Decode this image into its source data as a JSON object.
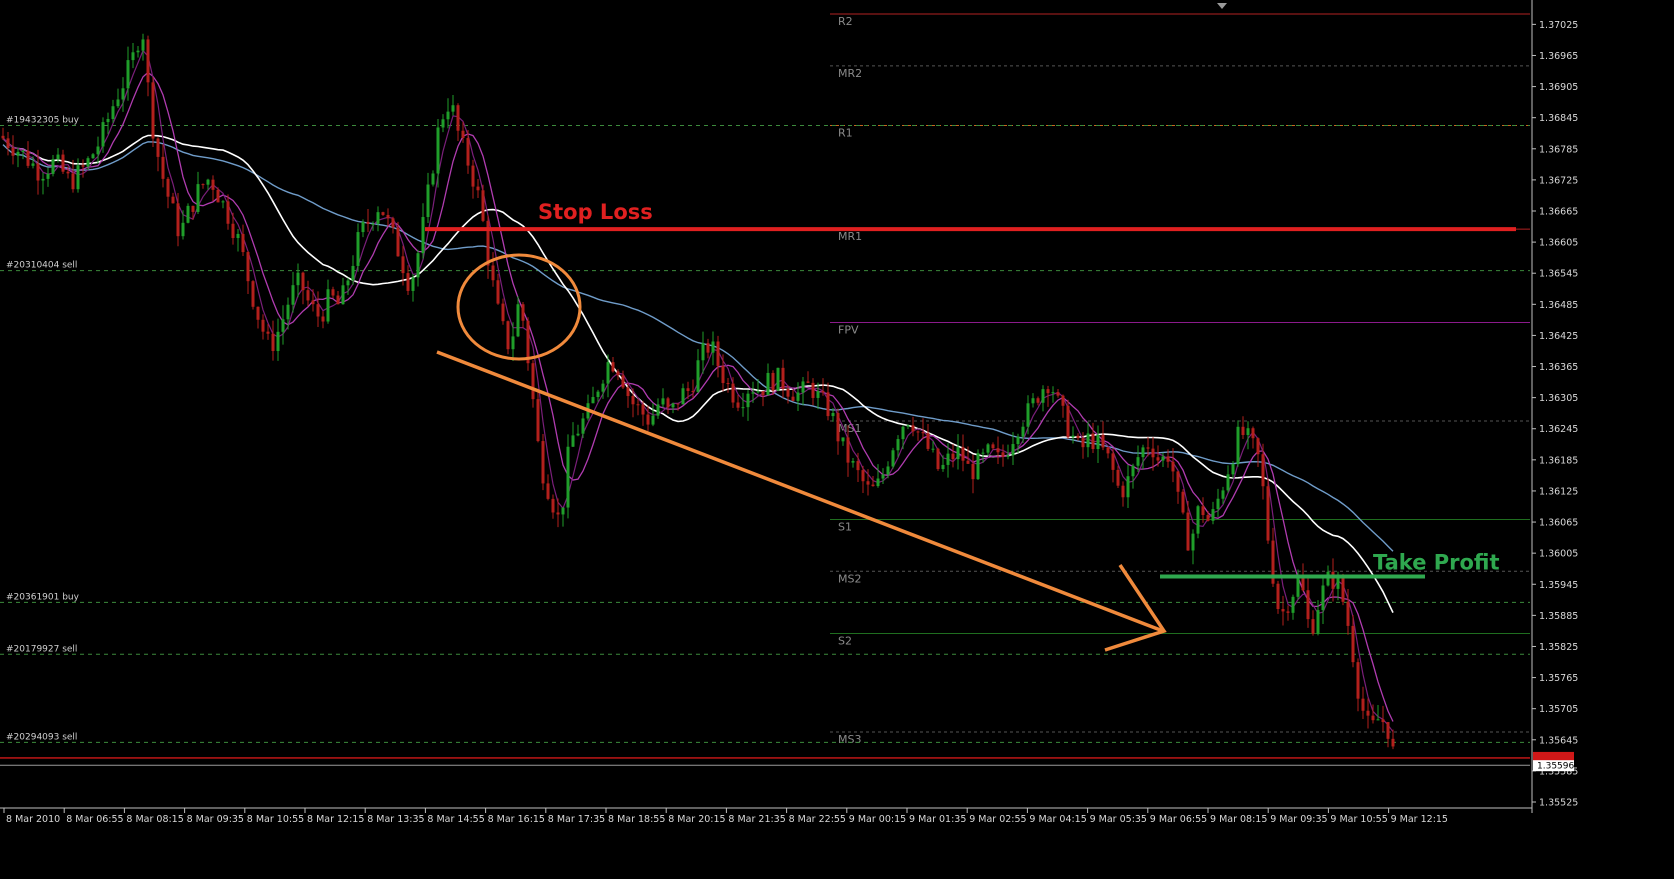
{
  "chart_data": {
    "type": "candlestick",
    "instrument_hint": "",
    "ylim": [
      1.3555,
      1.3705
    ],
    "y_ticks": [
      "1.37025",
      "1.36965",
      "1.36905",
      "1.36845",
      "1.36785",
      "1.36725",
      "1.36665",
      "1.36605",
      "1.36545",
      "1.36485",
      "1.36425",
      "1.36365",
      "1.36305",
      "1.36245",
      "1.36185",
      "1.36125",
      "1.36065",
      "1.36005",
      "1.35945",
      "1.35885",
      "1.35825",
      "1.35765",
      "1.35705",
      "1.35645",
      "1.35585",
      "1.35525"
    ],
    "y_tick_values": [
      1.37025,
      1.36965,
      1.36905,
      1.36845,
      1.36785,
      1.36725,
      1.36665,
      1.36605,
      1.36545,
      1.36485,
      1.36425,
      1.36365,
      1.36305,
      1.36245,
      1.36185,
      1.36125,
      1.36065,
      1.36005,
      1.35945,
      1.35885,
      1.35825,
      1.35765,
      1.35705,
      1.35645,
      1.35585,
      1.35525
    ],
    "x_ticks": [
      "8 Mar 2010",
      "8 Mar 06:55",
      "8 Mar 08:15",
      "8 Mar 09:35",
      "8 Mar 10:55",
      "8 Mar 12:15",
      "8 Mar 13:35",
      "8 Mar 14:55",
      "8 Mar 16:15",
      "8 Mar 17:35",
      "8 Mar 18:55",
      "8 Mar 20:15",
      "8 Mar 21:35",
      "8 Mar 22:55",
      "9 Mar 00:15",
      "9 Mar 01:35",
      "9 Mar 02:55",
      "9 Mar 04:15",
      "9 Mar 05:35",
      "9 Mar 06:55",
      "9 Mar 08:15",
      "9 Mar 09:35",
      "9 Mar 10:55",
      "9 Mar 12:15"
    ],
    "current_price_label": "1.35596",
    "current_price": 1.35596,
    "bid_line": 1.3561,
    "pivot_levels": [
      {
        "label": "R2",
        "value": 1.37045,
        "color": "#b22222",
        "style": "solid"
      },
      {
        "label": "MR2",
        "value": 1.36945,
        "color": "#555555",
        "style": "dashed"
      },
      {
        "label": "R1",
        "value": 1.3683,
        "color": "#c8641e",
        "style": "dashed"
      },
      {
        "label": "MR1",
        "value": 1.3663,
        "color": "#b22222",
        "style": "solid"
      },
      {
        "label": "FPV",
        "value": 1.3645,
        "color": "#8b1a8b",
        "style": "solid"
      },
      {
        "label": "MS1",
        "value": 1.3626,
        "color": "#555555",
        "style": "dashed"
      },
      {
        "label": "S1",
        "value": 1.3607,
        "color": "#1f6e1f",
        "style": "solid"
      },
      {
        "label": "MS2",
        "value": 1.3597,
        "color": "#555555",
        "style": "dashed"
      },
      {
        "label": "S2",
        "value": 1.3585,
        "color": "#1f6e1f",
        "style": "solid"
      },
      {
        "label": "MS3",
        "value": 1.3566,
        "color": "#555555",
        "style": "dashed"
      }
    ],
    "order_lines": [
      {
        "label": "#19432305 buy",
        "value": 1.3683
      },
      {
        "label": "#20310404 sell",
        "value": 1.3655
      },
      {
        "label": "#20361901 buy",
        "value": 1.3591
      },
      {
        "label": "#20179927 sell",
        "value": 1.3581
      },
      {
        "label": "#20294093 sell",
        "value": 1.3564
      }
    ],
    "annotations": {
      "stop_loss": {
        "label": "Stop Loss",
        "value": 1.3663,
        "color": "#e02020"
      },
      "take_profit": {
        "label": "Take Profit",
        "value": 1.3596,
        "color": "#2fa84f"
      },
      "trend_arrow_color": "#f08a3c",
      "circle_color": "#f08a3c"
    },
    "series_anchors": {
      "close": [
        [
          0,
          1.3681
        ],
        [
          20,
          1.3678
        ],
        [
          40,
          1.3674
        ],
        [
          55,
          1.3676
        ],
        [
          70,
          1.3672
        ],
        [
          85,
          1.3675
        ],
        [
          100,
          1.368
        ],
        [
          115,
          1.3688
        ],
        [
          125,
          1.3692
        ],
        [
          135,
          1.3697
        ],
        [
          142,
          1.3703
        ],
        [
          150,
          1.3686
        ],
        [
          160,
          1.3675
        ],
        [
          170,
          1.3668
        ],
        [
          180,
          1.3662
        ],
        [
          190,
          1.3667
        ],
        [
          200,
          1.3671
        ],
        [
          210,
          1.3673
        ],
        [
          220,
          1.3669
        ],
        [
          230,
          1.3665
        ],
        [
          240,
          1.366
        ],
        [
          250,
          1.3652
        ],
        [
          260,
          1.3645
        ],
        [
          270,
          1.364
        ],
        [
          280,
          1.3644
        ],
        [
          290,
          1.365
        ],
        [
          300,
          1.3653
        ],
        [
          310,
          1.3648
        ],
        [
          320,
          1.3646
        ],
        [
          330,
          1.365
        ],
        [
          340,
          1.3648
        ],
        [
          350,
          1.3655
        ],
        [
          360,
          1.3662
        ],
        [
          370,
          1.3665
        ],
        [
          380,
          1.3668
        ],
        [
          390,
          1.3663
        ],
        [
          400,
          1.3658
        ],
        [
          410,
          1.3652
        ],
        [
          420,
          1.366
        ],
        [
          430,
          1.3672
        ],
        [
          440,
          1.3684
        ],
        [
          450,
          1.3688
        ],
        [
          460,
          1.368
        ],
        [
          470,
          1.3675
        ],
        [
          480,
          1.3668
        ],
        [
          490,
          1.3655
        ],
        [
          500,
          1.3645
        ],
        [
          510,
          1.364
        ],
        [
          520,
          1.365
        ],
        [
          530,
          1.3635
        ],
        [
          540,
          1.3618
        ],
        [
          550,
          1.3612
        ],
        [
          560,
          1.3606
        ],
        [
          570,
          1.3622
        ],
        [
          580,
          1.3625
        ],
        [
          590,
          1.3628
        ],
        [
          600,
          1.3634
        ],
        [
          610,
          1.3638
        ],
        [
          620,
          1.3636
        ],
        [
          630,
          1.363
        ],
        [
          640,
          1.3628
        ],
        [
          650,
          1.3626
        ],
        [
          660,
          1.363
        ],
        [
          670,
          1.3627
        ],
        [
          680,
          1.3631
        ],
        [
          690,
          1.3632
        ],
        [
          700,
          1.3638
        ],
        [
          710,
          1.3641
        ],
        [
          720,
          1.3636
        ],
        [
          730,
          1.3632
        ],
        [
          740,
          1.363
        ],
        [
          750,
          1.3633
        ],
        [
          760,
          1.3632
        ],
        [
          770,
          1.3634
        ],
        [
          780,
          1.3634
        ],
        [
          790,
          1.3632
        ],
        [
          800,
          1.3631
        ],
        [
          810,
          1.3633
        ],
        [
          820,
          1.363
        ],
        [
          830,
          1.3628
        ],
        [
          840,
          1.3622
        ],
        [
          850,
          1.3618
        ],
        [
          860,
          1.3615
        ],
        [
          870,
          1.3612
        ],
        [
          880,
          1.3614
        ],
        [
          890,
          1.362
        ],
        [
          900,
          1.3625
        ],
        [
          910,
          1.3627
        ],
        [
          920,
          1.3623
        ],
        [
          930,
          1.362
        ],
        [
          940,
          1.3616
        ],
        [
          950,
          1.3619
        ],
        [
          960,
          1.362
        ],
        [
          970,
          1.3616
        ],
        [
          980,
          1.3618
        ],
        [
          990,
          1.362
        ],
        [
          1000,
          1.3618
        ],
        [
          1010,
          1.3622
        ],
        [
          1020,
          1.3626
        ],
        [
          1030,
          1.3628
        ],
        [
          1040,
          1.3632
        ],
        [
          1050,
          1.3634
        ],
        [
          1060,
          1.3628
        ],
        [
          1070,
          1.3624
        ],
        [
          1080,
          1.362
        ],
        [
          1090,
          1.3623
        ],
        [
          1100,
          1.3621
        ],
        [
          1110,
          1.3618
        ],
        [
          1120,
          1.3612
        ],
        [
          1130,
          1.3615
        ],
        [
          1140,
          1.362
        ],
        [
          1150,
          1.3622
        ],
        [
          1160,
          1.3618
        ],
        [
          1170,
          1.362
        ],
        [
          1180,
          1.3608
        ],
        [
          1190,
          1.3602
        ],
        [
          1200,
          1.361
        ],
        [
          1210,
          1.3606
        ],
        [
          1220,
          1.3612
        ],
        [
          1230,
          1.3618
        ],
        [
          1240,
          1.3624
        ],
        [
          1250,
          1.3622
        ],
        [
          1260,
          1.3618
        ],
        [
          1270,
          1.36
        ],
        [
          1280,
          1.3588
        ],
        [
          1290,
          1.3592
        ],
        [
          1300,
          1.3596
        ],
        [
          1310,
          1.3585
        ],
        [
          1320,
          1.3592
        ],
        [
          1330,
          1.3596
        ],
        [
          1340,
          1.3594
        ],
        [
          1350,
          1.3585
        ],
        [
          1360,
          1.3572
        ],
        [
          1370,
          1.3566
        ],
        [
          1380,
          1.3569
        ],
        [
          1390,
          1.3566
        ],
        [
          1396,
          1.3558
        ]
      ]
    }
  }
}
